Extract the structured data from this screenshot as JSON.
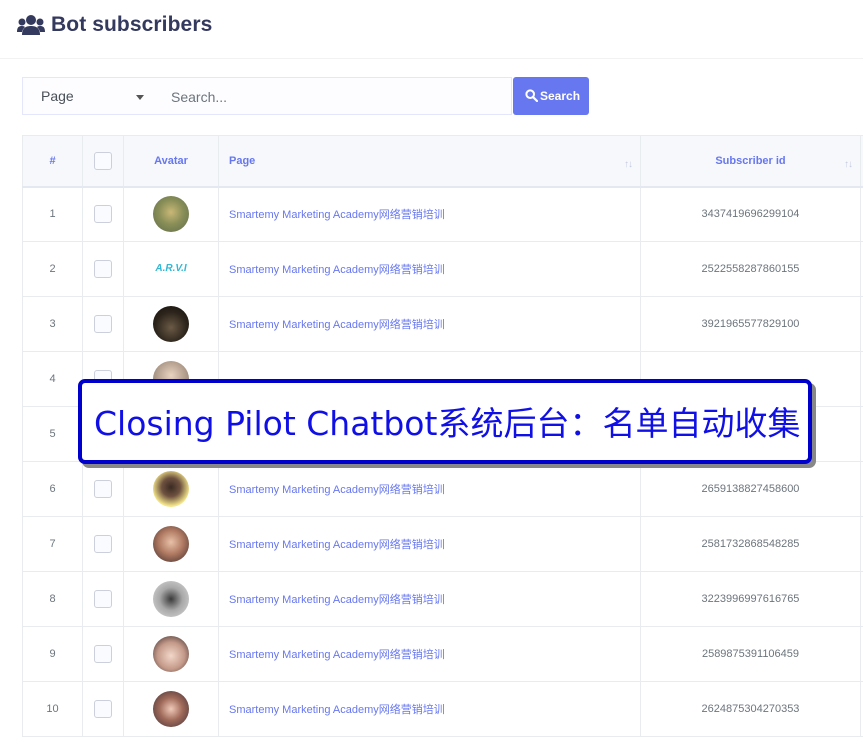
{
  "header": {
    "title": "Bot subscribers",
    "icon": "users-icon"
  },
  "search": {
    "select_value": "Page",
    "placeholder": "Search...",
    "button_label": "Search",
    "accent": "#6777ef"
  },
  "table": {
    "columns": [
      "#",
      "",
      "Avatar",
      "Page",
      "Subscriber id"
    ],
    "rows": [
      {
        "num": "1",
        "page": "Smartemy Marketing Academy",
        "page_cn": "网络营销培训",
        "subscriber_id": "3437419696299104"
      },
      {
        "num": "2",
        "page": "Smartemy Marketing Academy",
        "page_cn": "网络营销培训",
        "subscriber_id": "2522558287860155",
        "avatar_text": "A.R.V.I"
      },
      {
        "num": "3",
        "page": "Smartemy Marketing Academy",
        "page_cn": "网络营销培训",
        "subscriber_id": "3921965577829100"
      },
      {
        "num": "4",
        "page": "",
        "page_cn": "",
        "subscriber_id": ""
      },
      {
        "num": "5",
        "page": "",
        "page_cn": "",
        "subscriber_id": ""
      },
      {
        "num": "6",
        "page": "Smartemy Marketing Academy",
        "page_cn": "网络营销培训",
        "subscriber_id": "2659138827458600"
      },
      {
        "num": "7",
        "page": "Smartemy Marketing Academy",
        "page_cn": "网络营销培训",
        "subscriber_id": "2581732868548285"
      },
      {
        "num": "8",
        "page": "Smartemy Marketing Academy",
        "page_cn": "网络营销培训",
        "subscriber_id": "3223996997616765"
      },
      {
        "num": "9",
        "page": "Smartemy Marketing Academy",
        "page_cn": "网络营销培训",
        "subscriber_id": "2589875391106459"
      },
      {
        "num": "10",
        "page": "Smartemy Marketing Academy",
        "page_cn": "网络营销培训",
        "subscriber_id": "2624875304270353"
      }
    ]
  },
  "overlay": {
    "text": "Closing Pilot Chatbot系统后台：名单自动收集"
  }
}
